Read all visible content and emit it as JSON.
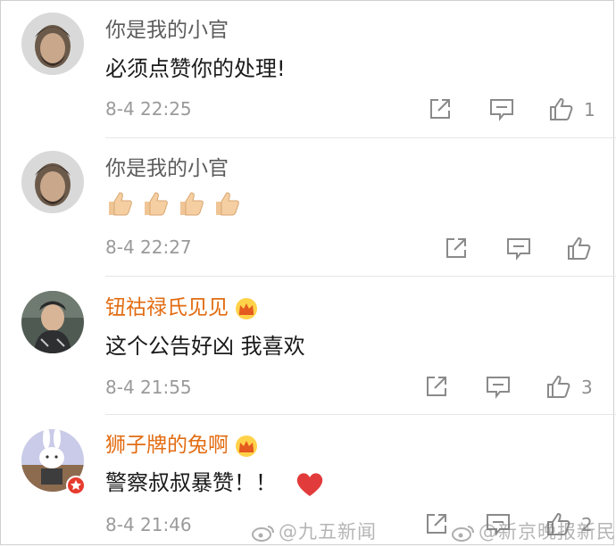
{
  "comments": [
    {
      "username": "你是我的小官",
      "text": "必须点赞你的处理!",
      "time": "8-4 22:25",
      "likes": "1"
    },
    {
      "username": "你是我的小官",
      "text": "",
      "emoji_icons": [
        "thumbs-up-icon",
        "thumbs-up-icon",
        "thumbs-up-icon",
        "thumbs-up-icon"
      ],
      "time": "8-4 22:27",
      "likes": ""
    },
    {
      "username": "钮祜禄氏见见",
      "text": "这个公告好凶 我喜欢",
      "time": "8-4 21:55",
      "likes": "3"
    },
    {
      "username": "狮子牌的兔啊",
      "text": "警察叔叔暴赞！！",
      "time": "8-4 21:46",
      "likes": "2"
    }
  ],
  "watermarks": {
    "left": "@九五新闻",
    "right": "@新京晚报新民网"
  },
  "colors": {
    "vip_name": "#e26c12",
    "plain_name": "#5c5c5c",
    "meta": "#9a9a9a",
    "heart": "#e23b3b"
  }
}
